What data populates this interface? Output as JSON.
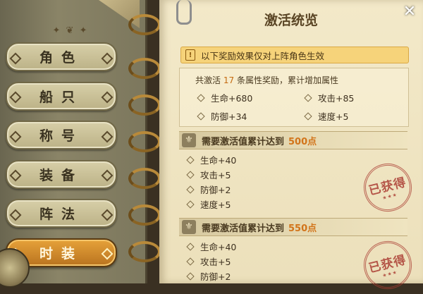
{
  "nav": {
    "items": [
      {
        "label": "角色"
      },
      {
        "label": "船只"
      },
      {
        "label": "称号"
      },
      {
        "label": "装备"
      },
      {
        "label": "阵法"
      },
      {
        "label": "时装",
        "active": true
      }
    ]
  },
  "panel": {
    "title": "激活统览",
    "notice": "以下奖励效果仅对上阵角色生效",
    "summary": {
      "prefix": "共激活",
      "count": "17",
      "suffix": "条属性奖励，累计增加属性",
      "stats": [
        "生命+680",
        "攻击+85",
        "防御+34",
        "速度+5"
      ]
    },
    "sections": [
      {
        "label": "需要激活值累计达到",
        "points": "500点",
        "stats": [
          "生命+40",
          "攻击+5",
          "防御+2",
          "速度+5"
        ],
        "stamp": "已获得"
      },
      {
        "label": "需要激活值累计达到",
        "points": "550点",
        "stats": [
          "生命+40",
          "攻击+5",
          "防御+2"
        ],
        "stamp": "已获得"
      }
    ]
  },
  "colors": {
    "accent_orange": "#d2741a",
    "notice_bg": "#f6d37a",
    "active_tab": "#e6a23a",
    "stamp_red": "#aa3c32"
  }
}
